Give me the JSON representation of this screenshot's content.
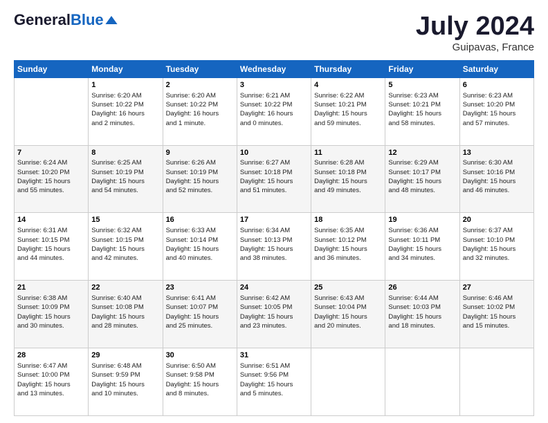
{
  "header": {
    "logo_general": "General",
    "logo_blue": "Blue",
    "month_year": "July 2024",
    "location": "Guipavas, France"
  },
  "weekdays": [
    "Sunday",
    "Monday",
    "Tuesday",
    "Wednesday",
    "Thursday",
    "Friday",
    "Saturday"
  ],
  "weeks": [
    [
      {
        "day": "",
        "info": ""
      },
      {
        "day": "1",
        "info": "Sunrise: 6:20 AM\nSunset: 10:22 PM\nDaylight: 16 hours\nand 2 minutes."
      },
      {
        "day": "2",
        "info": "Sunrise: 6:20 AM\nSunset: 10:22 PM\nDaylight: 16 hours\nand 1 minute."
      },
      {
        "day": "3",
        "info": "Sunrise: 6:21 AM\nSunset: 10:22 PM\nDaylight: 16 hours\nand 0 minutes."
      },
      {
        "day": "4",
        "info": "Sunrise: 6:22 AM\nSunset: 10:21 PM\nDaylight: 15 hours\nand 59 minutes."
      },
      {
        "day": "5",
        "info": "Sunrise: 6:23 AM\nSunset: 10:21 PM\nDaylight: 15 hours\nand 58 minutes."
      },
      {
        "day": "6",
        "info": "Sunrise: 6:23 AM\nSunset: 10:20 PM\nDaylight: 15 hours\nand 57 minutes."
      }
    ],
    [
      {
        "day": "7",
        "info": "Sunrise: 6:24 AM\nSunset: 10:20 PM\nDaylight: 15 hours\nand 55 minutes."
      },
      {
        "day": "8",
        "info": "Sunrise: 6:25 AM\nSunset: 10:19 PM\nDaylight: 15 hours\nand 54 minutes."
      },
      {
        "day": "9",
        "info": "Sunrise: 6:26 AM\nSunset: 10:19 PM\nDaylight: 15 hours\nand 52 minutes."
      },
      {
        "day": "10",
        "info": "Sunrise: 6:27 AM\nSunset: 10:18 PM\nDaylight: 15 hours\nand 51 minutes."
      },
      {
        "day": "11",
        "info": "Sunrise: 6:28 AM\nSunset: 10:18 PM\nDaylight: 15 hours\nand 49 minutes."
      },
      {
        "day": "12",
        "info": "Sunrise: 6:29 AM\nSunset: 10:17 PM\nDaylight: 15 hours\nand 48 minutes."
      },
      {
        "day": "13",
        "info": "Sunrise: 6:30 AM\nSunset: 10:16 PM\nDaylight: 15 hours\nand 46 minutes."
      }
    ],
    [
      {
        "day": "14",
        "info": "Sunrise: 6:31 AM\nSunset: 10:15 PM\nDaylight: 15 hours\nand 44 minutes."
      },
      {
        "day": "15",
        "info": "Sunrise: 6:32 AM\nSunset: 10:15 PM\nDaylight: 15 hours\nand 42 minutes."
      },
      {
        "day": "16",
        "info": "Sunrise: 6:33 AM\nSunset: 10:14 PM\nDaylight: 15 hours\nand 40 minutes."
      },
      {
        "day": "17",
        "info": "Sunrise: 6:34 AM\nSunset: 10:13 PM\nDaylight: 15 hours\nand 38 minutes."
      },
      {
        "day": "18",
        "info": "Sunrise: 6:35 AM\nSunset: 10:12 PM\nDaylight: 15 hours\nand 36 minutes."
      },
      {
        "day": "19",
        "info": "Sunrise: 6:36 AM\nSunset: 10:11 PM\nDaylight: 15 hours\nand 34 minutes."
      },
      {
        "day": "20",
        "info": "Sunrise: 6:37 AM\nSunset: 10:10 PM\nDaylight: 15 hours\nand 32 minutes."
      }
    ],
    [
      {
        "day": "21",
        "info": "Sunrise: 6:38 AM\nSunset: 10:09 PM\nDaylight: 15 hours\nand 30 minutes."
      },
      {
        "day": "22",
        "info": "Sunrise: 6:40 AM\nSunset: 10:08 PM\nDaylight: 15 hours\nand 28 minutes."
      },
      {
        "day": "23",
        "info": "Sunrise: 6:41 AM\nSunset: 10:07 PM\nDaylight: 15 hours\nand 25 minutes."
      },
      {
        "day": "24",
        "info": "Sunrise: 6:42 AM\nSunset: 10:05 PM\nDaylight: 15 hours\nand 23 minutes."
      },
      {
        "day": "25",
        "info": "Sunrise: 6:43 AM\nSunset: 10:04 PM\nDaylight: 15 hours\nand 20 minutes."
      },
      {
        "day": "26",
        "info": "Sunrise: 6:44 AM\nSunset: 10:03 PM\nDaylight: 15 hours\nand 18 minutes."
      },
      {
        "day": "27",
        "info": "Sunrise: 6:46 AM\nSunset: 10:02 PM\nDaylight: 15 hours\nand 15 minutes."
      }
    ],
    [
      {
        "day": "28",
        "info": "Sunrise: 6:47 AM\nSunset: 10:00 PM\nDaylight: 15 hours\nand 13 minutes."
      },
      {
        "day": "29",
        "info": "Sunrise: 6:48 AM\nSunset: 9:59 PM\nDaylight: 15 hours\nand 10 minutes."
      },
      {
        "day": "30",
        "info": "Sunrise: 6:50 AM\nSunset: 9:58 PM\nDaylight: 15 hours\nand 8 minutes."
      },
      {
        "day": "31",
        "info": "Sunrise: 6:51 AM\nSunset: 9:56 PM\nDaylight: 15 hours\nand 5 minutes."
      },
      {
        "day": "",
        "info": ""
      },
      {
        "day": "",
        "info": ""
      },
      {
        "day": "",
        "info": ""
      }
    ]
  ]
}
